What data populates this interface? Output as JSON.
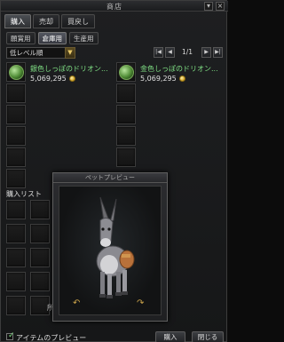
{
  "window": {
    "title": "商店",
    "close": "×"
  },
  "tabs": [
    {
      "label": "購入"
    },
    {
      "label": "売却"
    },
    {
      "label": "買戻し"
    }
  ],
  "subtabs": [
    {
      "label": "願賞用"
    },
    {
      "label": "倉庫用"
    },
    {
      "label": "生産用"
    }
  ],
  "sort": {
    "value": "低レベル順"
  },
  "pager": {
    "page": "1/1"
  },
  "items": [
    {
      "name": "銀色しっぽのドリオン...",
      "price": "5,069,295"
    },
    {
      "name": "金色しっぽのドリオン...",
      "price": "5,069,295"
    }
  ],
  "buy_list": {
    "label": "購入リスト"
  },
  "preview_popup": {
    "title": "ペットプレビュー"
  },
  "footer": {
    "preview_label": "アイテムのプレビュー",
    "buy_button": "購入",
    "close_button": "閉じる"
  },
  "truncated_text": "所"
}
